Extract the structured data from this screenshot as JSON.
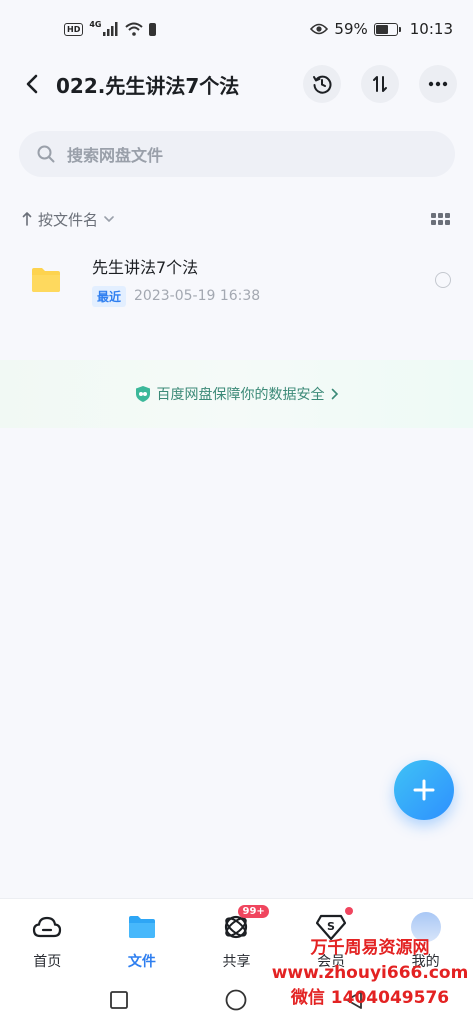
{
  "status_bar": {
    "network": "4G",
    "hd": "HD",
    "battery_percent": "59%",
    "battery_level": 0.59,
    "time": "10:13"
  },
  "header": {
    "title": "022.先生讲法7个法"
  },
  "search": {
    "placeholder": "搜索网盘文件"
  },
  "sort": {
    "label": "按文件名"
  },
  "files": [
    {
      "name": "先生讲法7个法",
      "tag": "最近",
      "date": "2023-05-19  16:38",
      "type": "folder"
    }
  ],
  "banner": {
    "text": "百度网盘保障你的数据安全"
  },
  "tabs": [
    {
      "label": "首页",
      "icon": "cloud-icon"
    },
    {
      "label": "文件",
      "icon": "folder-icon",
      "active": true
    },
    {
      "label": "共享",
      "icon": "share-icon",
      "badge": "99+"
    },
    {
      "label": "会员",
      "icon": "vip-icon"
    },
    {
      "label": "我的",
      "icon": "avatar"
    }
  ],
  "watermark": {
    "line1": "万千周易资源网",
    "line2": "www.zhouyi666.com",
    "line3": "微信 1404049576"
  },
  "colors": {
    "accent": "#2f7ff0",
    "fab_start": "#3fc2f5",
    "fab_end": "#2e90ff",
    "folder": "#fdd34f",
    "badge": "#f0455e",
    "watermark": "#e32222"
  }
}
